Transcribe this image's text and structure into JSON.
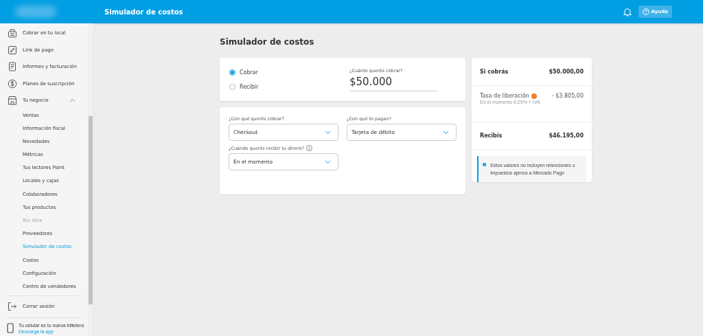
{
  "header": {
    "title": "Simulador de costos",
    "help_button": "Ayuda"
  },
  "sidebar": {
    "items": [
      {
        "label": "Cobrar en tu local"
      },
      {
        "label": "Link de pago"
      },
      {
        "label": "Informes y facturación"
      },
      {
        "label": "Planes de suscripción"
      },
      {
        "label": "Tu negocio",
        "expanded": true,
        "children": [
          {
            "label": "Ventas",
            "selected": false,
            "disabled": false
          },
          {
            "label": "Información fiscal",
            "selected": false,
            "disabled": false
          },
          {
            "label": "Novedades",
            "selected": false,
            "disabled": false
          },
          {
            "label": "Métricas",
            "selected": false,
            "disabled": false
          },
          {
            "label": "Tus lectores Point",
            "selected": false,
            "disabled": false
          },
          {
            "label": "Locales y cajas",
            "selected": false,
            "disabled": false
          },
          {
            "label": "Colaboradores",
            "selected": false,
            "disabled": false
          },
          {
            "label": "Tus productos",
            "selected": false,
            "disabled": false
          },
          {
            "label": "Bio libre",
            "selected": false,
            "disabled": true
          },
          {
            "label": "Proveedores",
            "selected": false,
            "disabled": false
          },
          {
            "label": "Simulador de costos",
            "selected": true,
            "disabled": false
          },
          {
            "label": "Costos",
            "selected": false,
            "disabled": false
          },
          {
            "label": "Configuración",
            "selected": false,
            "disabled": false
          },
          {
            "label": "Centro de vendedores",
            "selected": false,
            "disabled": false
          }
        ]
      }
    ],
    "logout": "Cerrar sesión",
    "promo": {
      "text": "Tu celular es tu nueva billetera",
      "link": "Descargá la app"
    }
  },
  "page_title": "Simulador de costos",
  "mode": {
    "options": [
      {
        "label": "Cobrar",
        "selected": true
      },
      {
        "label": "Recibir",
        "selected": false
      }
    ]
  },
  "amount": {
    "label": "¿Cuánto querés cobrar?",
    "value": "$50.000"
  },
  "selects": [
    {
      "label": "¿Con qué querés cobrar?",
      "value": "Checkout",
      "info": false
    },
    {
      "label": "¿Con qué te pagan?",
      "value": "Tarjeta de débito",
      "info": false
    },
    {
      "label": "¿Cuándo querés recibir tu dinero?",
      "value": "En el momento",
      "info": true
    }
  ],
  "summary": {
    "charge": {
      "label": "Si cobrás",
      "value": "$50.000,00"
    },
    "fee": {
      "label": "Tasa de liberación",
      "value": "- $3.805,00",
      "detail": "En el momento 6,29% + IVA"
    },
    "receive": {
      "label": "Recibís",
      "value": "$46.195,00"
    },
    "note": "Estos valores no incluyen retenciones o impuestos ajenos a Mercado Pago"
  }
}
